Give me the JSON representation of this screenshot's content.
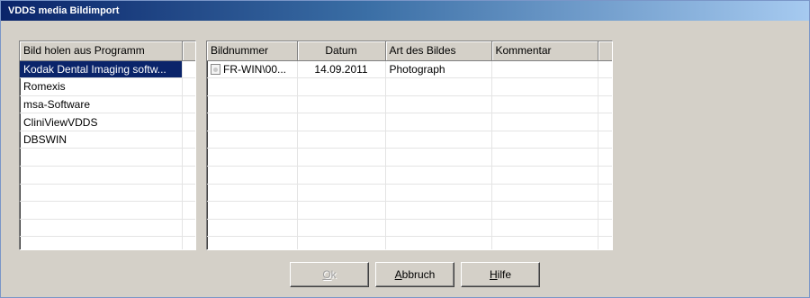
{
  "window": {
    "title": "VDDS media Bildimport"
  },
  "program_list": {
    "header": "Bild holen aus Programm",
    "items": [
      "Kodak Dental Imaging softw...",
      "Romexis",
      "msa-Software",
      "CliniViewVDDS",
      "DBSWIN"
    ],
    "selected_index": 0
  },
  "image_table": {
    "columns": [
      "Bildnummer",
      "Datum",
      "Art des Bildes",
      "Kommentar"
    ],
    "rows": [
      {
        "icon": "image-file-icon",
        "bildnummer": "FR-WIN\\00...",
        "datum": "14.09.2011",
        "art": "Photograph",
        "kommentar": ""
      }
    ]
  },
  "buttons": {
    "ok": {
      "label": "Ok",
      "mnemonic": "O",
      "rest": "k",
      "enabled": false
    },
    "abbruch": {
      "label": "Abbruch",
      "mnemonic": "A",
      "rest": "bbruch",
      "enabled": true
    },
    "hilfe": {
      "label": "Hilfe",
      "mnemonic": "H",
      "rest": "ilfe",
      "enabled": true
    }
  }
}
